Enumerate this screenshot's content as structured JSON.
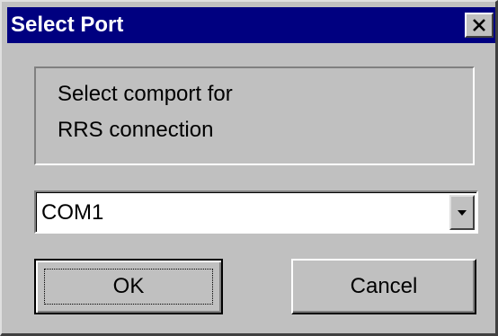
{
  "window": {
    "title": "Select Port",
    "close_icon": "close-icon",
    "title_bar_color": "#000080"
  },
  "message": {
    "line1": "Select comport for",
    "line2": "RRS connection"
  },
  "port_select": {
    "value": "COM1",
    "arrow_icon": "chevron-down-icon"
  },
  "buttons": {
    "ok_label": "OK",
    "cancel_label": "Cancel"
  }
}
